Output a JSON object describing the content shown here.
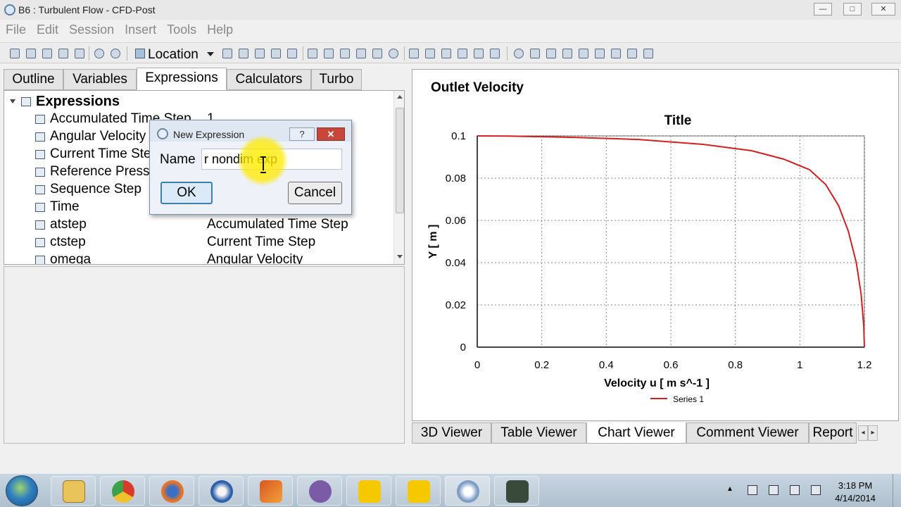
{
  "window": {
    "title": "B6 : Turbulent Flow - CFD-Post",
    "min": "—",
    "max": "□",
    "close": "✕"
  },
  "menu": [
    "File",
    "Edit",
    "Session",
    "Insert",
    "Tools",
    "Help"
  ],
  "toolbar": {
    "location_label": "Location"
  },
  "left_tabs": [
    "Outline",
    "Variables",
    "Expressions",
    "Calculators",
    "Turbo"
  ],
  "active_left_tab": "Expressions",
  "tree": {
    "root": "Expressions",
    "items": [
      {
        "name": "Accumulated Time Step",
        "value": "1"
      },
      {
        "name": "Angular Velocity",
        "value": ""
      },
      {
        "name": "Current Time Step",
        "value": ""
      },
      {
        "name": "Reference Pressure",
        "value": ""
      },
      {
        "name": "Sequence Step",
        "value": ""
      },
      {
        "name": "Time",
        "value": ""
      },
      {
        "name": "atstep",
        "value": "Accumulated Time Step"
      },
      {
        "name": "ctstep",
        "value": "Current Time Step"
      },
      {
        "name": "omega",
        "value": "Angular Velocity"
      }
    ]
  },
  "dialog": {
    "title": "New Expression",
    "help": "?",
    "close": "✕",
    "name_label": "Name",
    "name_value": "r nondim exp",
    "ok_label": "OK",
    "cancel_label": "Cancel"
  },
  "chart_panel": {
    "heading": "Outlet Velocity"
  },
  "chart_data": {
    "type": "line",
    "title": "Title",
    "xlabel": "Velocity u [ m s^-1 ]",
    "ylabel": "Y [ m ]",
    "xlim": [
      0,
      1.2
    ],
    "ylim": [
      0,
      0.1
    ],
    "xticks": [
      "0",
      "0.2",
      "0.4",
      "0.6",
      "0.8",
      "1",
      "1.2"
    ],
    "yticks": [
      "0",
      "0.02",
      "0.04",
      "0.06",
      "0.08",
      "0.1"
    ],
    "grid": true,
    "legend": "bottom",
    "series": [
      {
        "name": "Series 1",
        "color": "#d42020",
        "x": [
          1.2,
          1.198,
          1.19,
          1.175,
          1.15,
          1.12,
          1.08,
          1.03,
          0.95,
          0.85,
          0.7,
          0.5,
          0.3,
          0.1,
          0.0
        ],
        "y": [
          0.0,
          0.01,
          0.025,
          0.04,
          0.055,
          0.067,
          0.077,
          0.084,
          0.089,
          0.093,
          0.096,
          0.0983,
          0.0993,
          0.0999,
          0.1
        ]
      }
    ]
  },
  "bottom_tabs": [
    "3D Viewer",
    "Table Viewer",
    "Chart Viewer",
    "Comment Viewer",
    "Report"
  ],
  "active_bottom_tab": "Chart Viewer",
  "taskbar": {
    "time": "3:18 PM",
    "date": "4/14/2014",
    "apps": [
      "explorer",
      "chrome",
      "firefox",
      "thunderbird",
      "matlab",
      "emacs",
      "ansys-workbench",
      "ansys-fluent",
      "cfd-post",
      "terminal"
    ]
  }
}
